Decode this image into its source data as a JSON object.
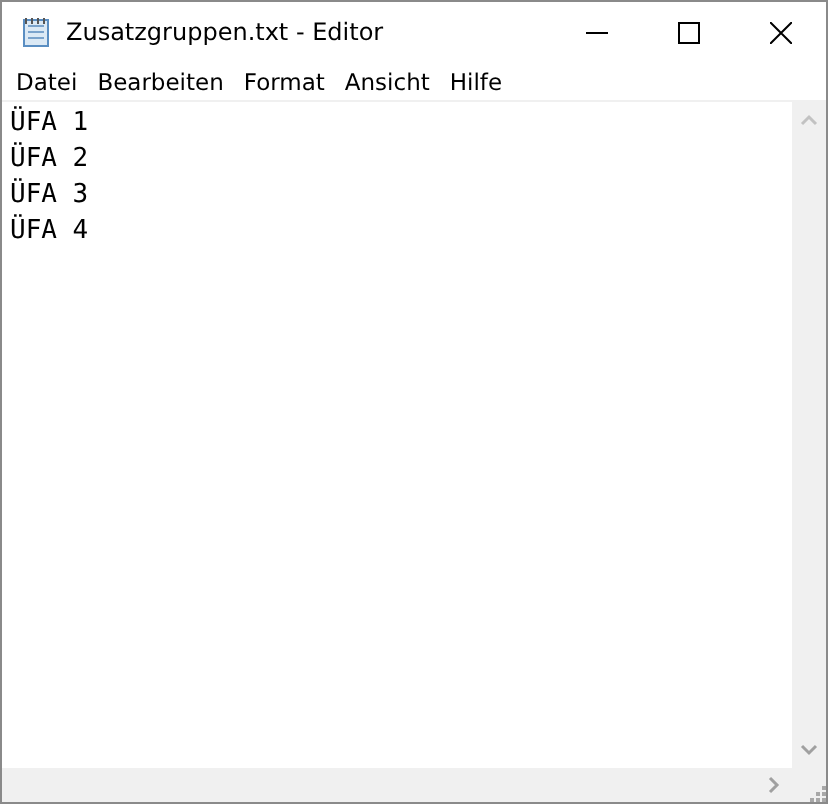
{
  "window": {
    "title": "Zusatzgruppen.txt - Editor"
  },
  "menu": [
    {
      "label": "Datei"
    },
    {
      "label": "Bearbeiten"
    },
    {
      "label": "Format"
    },
    {
      "label": "Ansicht"
    },
    {
      "label": "Hilfe"
    }
  ],
  "document": {
    "lines": [
      "ÜFA 1",
      "ÜFA 2",
      "ÜFA 3",
      "ÜFA 4"
    ]
  }
}
